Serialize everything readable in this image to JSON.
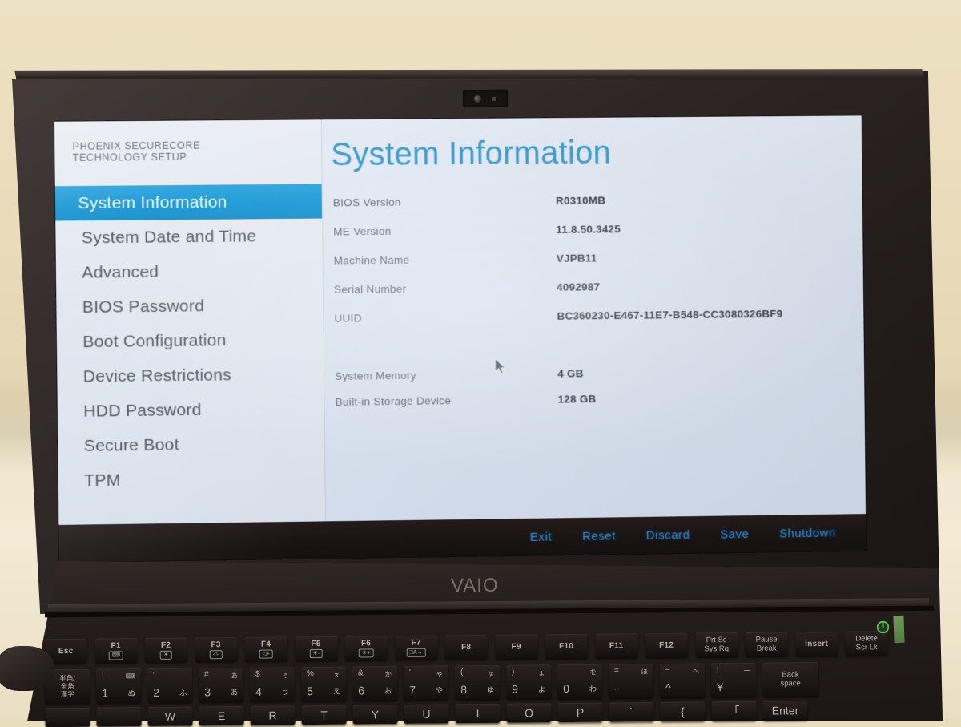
{
  "photo": {
    "device": "VAIO laptop",
    "brand_logo": "VAIO",
    "power_led_icon": "power-icon"
  },
  "bios": {
    "brand_heading": "PHOENIX SECURECORE\nTECHNOLOGY SETUP",
    "accent_color": "#1295d4",
    "title_color": "#3a9bcf",
    "link_color": "#2f8ed8",
    "sidebar": {
      "items": [
        {
          "label": "System Information",
          "active": true
        },
        {
          "label": "System Date and Time",
          "active": false
        },
        {
          "label": "Advanced",
          "active": false
        },
        {
          "label": "BIOS Password",
          "active": false
        },
        {
          "label": "Boot Configuration",
          "active": false
        },
        {
          "label": "Device Restrictions",
          "active": false
        },
        {
          "label": "HDD Password",
          "active": false
        },
        {
          "label": "Secure Boot",
          "active": false
        },
        {
          "label": "TPM",
          "active": false
        }
      ]
    },
    "page_title": "System Information",
    "info_rows": [
      {
        "label": "BIOS Version",
        "value": "R0310MB"
      },
      {
        "label": "ME Version",
        "value": "11.8.50.3425"
      },
      {
        "label": "Machine Name",
        "value": "VJPB11"
      },
      {
        "label": "Serial Number",
        "value": "4092987"
      },
      {
        "label": "UUID",
        "value": "BC360230-E467-11E7-B548-CC3080326BF9"
      },
      {
        "label": "System Memory",
        "value": "4 GB"
      },
      {
        "label": "Built-in Storage Device",
        "value": "128 GB"
      }
    ],
    "actions": [
      {
        "label": "Exit"
      },
      {
        "label": "Reset"
      },
      {
        "label": "Discard"
      },
      {
        "label": "Save"
      },
      {
        "label": "Shutdown"
      }
    ]
  },
  "keyboard": {
    "function_row": [
      {
        "label": "Esc",
        "sub": ""
      },
      {
        "label": "F1",
        "sub": "⌨"
      },
      {
        "label": "F2",
        "sub": "☀"
      },
      {
        "label": "F3",
        "sub": "◁-"
      },
      {
        "label": "F4",
        "sub": "◁+"
      },
      {
        "label": "F5",
        "sub": "☀-"
      },
      {
        "label": "F6",
        "sub": "☀+"
      },
      {
        "label": "F7",
        "sub": "□A→"
      },
      {
        "label": "F8",
        "sub": ""
      },
      {
        "label": "F9",
        "sub": ""
      },
      {
        "label": "F10",
        "sub": ""
      },
      {
        "label": "F11",
        "sub": ""
      },
      {
        "label": "F12",
        "sub": ""
      },
      {
        "label": "Prt Sc\nSys Rq",
        "sub": ""
      },
      {
        "label": "Pause\nBreak",
        "sub": ""
      },
      {
        "label": "Insert",
        "sub": ""
      },
      {
        "label": "Delete\nScr Lk",
        "sub": ""
      }
    ],
    "number_row": [
      {
        "top": "",
        "topr": "",
        "bot": "半角/\n全角\n漢字",
        "botr": "",
        "multi": true
      },
      {
        "top": "!",
        "topr": "⌨",
        "bot": "1",
        "botr": "ぬ"
      },
      {
        "top": "\"",
        "topr": "",
        "bot": "2",
        "botr": "ふ"
      },
      {
        "top": "#",
        "topr": "あ",
        "bot": "3",
        "botr": "あ"
      },
      {
        "top": "$",
        "topr": "ぅ",
        "bot": "4",
        "botr": "う"
      },
      {
        "top": "%",
        "topr": "え",
        "bot": "5",
        "botr": "え"
      },
      {
        "top": "&",
        "topr": "か",
        "bot": "6",
        "botr": "お"
      },
      {
        "top": "'",
        "topr": "ゃ",
        "bot": "7",
        "botr": "や"
      },
      {
        "top": "(",
        "topr": "ゅ",
        "bot": "8",
        "botr": "ゆ"
      },
      {
        "top": ")",
        "topr": "ょ",
        "bot": "9",
        "botr": "よ"
      },
      {
        "top": "",
        "topr": "を",
        "bot": "0",
        "botr": "わ"
      },
      {
        "top": "=",
        "topr": "ほ",
        "bot": "-",
        "botr": ""
      },
      {
        "top": "~",
        "topr": "へ",
        "bot": "^",
        "botr": ""
      },
      {
        "top": "|",
        "topr": "ー",
        "bot": "¥",
        "botr": ""
      },
      {
        "top": "",
        "topr": "",
        "bot": "Back\nspace",
        "botr": "",
        "two": true
      }
    ],
    "qwerty_row": [
      {
        "label": ""
      },
      {
        "label": ""
      },
      {
        "label": "W"
      },
      {
        "label": "E"
      },
      {
        "label": "R"
      },
      {
        "label": "T"
      },
      {
        "label": "Y"
      },
      {
        "label": "U"
      },
      {
        "label": "I"
      },
      {
        "label": "O"
      },
      {
        "label": "P"
      },
      {
        "label": "`"
      },
      {
        "label": "{"
      },
      {
        "label": "「"
      },
      {
        "label": "Enter"
      }
    ]
  }
}
